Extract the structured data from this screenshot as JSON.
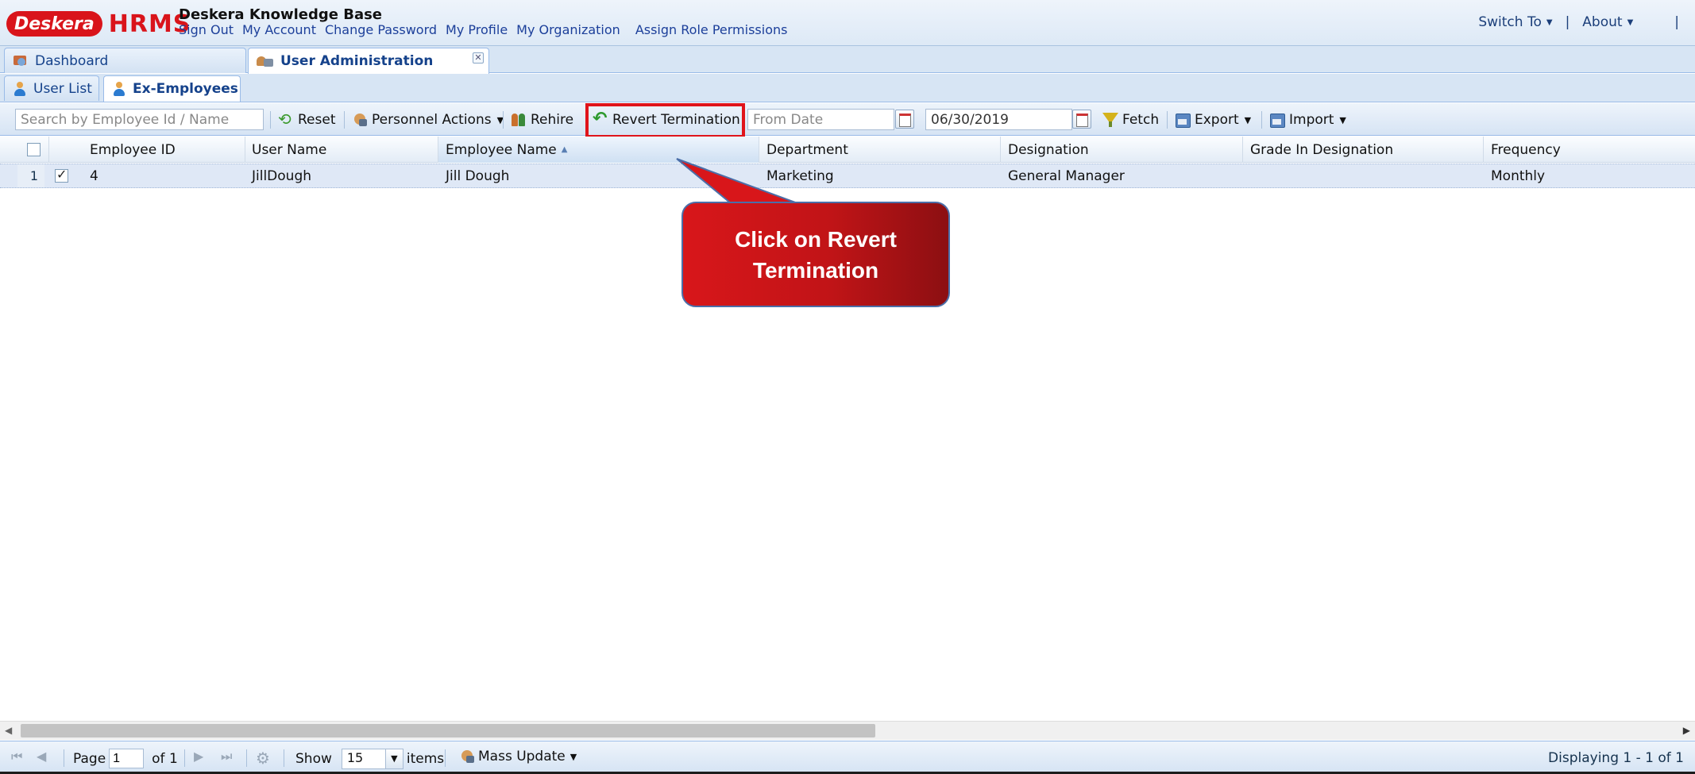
{
  "header": {
    "brand": "Deskera",
    "product": "HRMS",
    "kb_title": "Deskera Knowledge Base",
    "links": [
      "Sign Out",
      "My Account",
      "Change Password",
      "My Profile",
      "My Organization",
      "Assign Role Permissions"
    ],
    "switch_to": "Switch To",
    "about": "About"
  },
  "main_tabs": [
    {
      "label": "Dashboard",
      "active": false
    },
    {
      "label": "User Administration",
      "active": true
    }
  ],
  "sub_tabs": [
    {
      "label": "User List",
      "active": false
    },
    {
      "label": "Ex-Employees",
      "active": true
    }
  ],
  "toolbar": {
    "search_placeholder": "Search by Employee Id / Name",
    "reset": "Reset",
    "personnel_actions": "Personnel Actions",
    "rehire": "Rehire",
    "revert_termination": "Revert Termination",
    "from_date_placeholder": "From Date",
    "to_date_value": "06/30/2019",
    "fetch": "Fetch",
    "export": "Export",
    "import": "Import"
  },
  "grid": {
    "columns": [
      "Employee ID",
      "User Name",
      "Employee Name",
      "Department",
      "Designation",
      "Grade In Designation",
      "Frequency"
    ],
    "sorted_column": "Employee Name",
    "rows": [
      {
        "row_number": "1",
        "checked": true,
        "employee_id": "4",
        "user_name": "JillDough",
        "employee_name": "Jill Dough",
        "department": "Marketing",
        "designation": "General Manager",
        "grade": "",
        "frequency": "Monthly"
      }
    ]
  },
  "callout": {
    "text": "Click on Revert Termination",
    "color": "#d8161a"
  },
  "paging": {
    "page_label": "Page",
    "page_value": "1",
    "of_label": "of 1",
    "show_label": "Show",
    "show_value": "15",
    "items_label": "items",
    "mass_update": "Mass Update",
    "display_info": "Displaying 1 - 1 of 1"
  },
  "colors": {
    "brand_red": "#d9141b",
    "highlight_red": "#e0141b",
    "toolbar_blue": "#d6e4f4"
  }
}
